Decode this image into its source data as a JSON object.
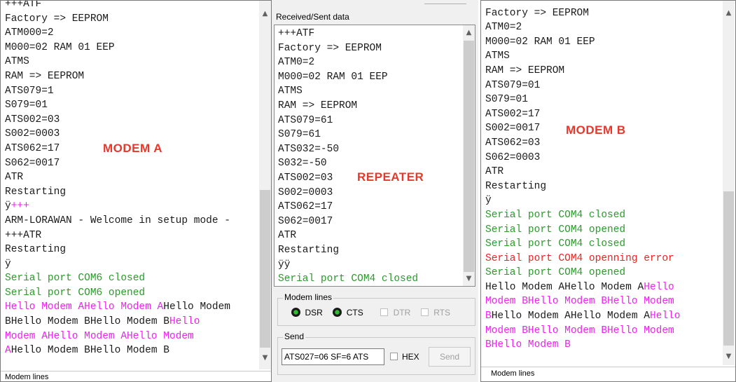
{
  "modem_a": {
    "label": "MODEM A",
    "lines": [
      [
        {
          "t": "+++ATF",
          "c": "dark"
        }
      ],
      [
        {
          "t": "Factory => EEPROM",
          "c": "dark"
        }
      ],
      [
        {
          "t": "ATM000=2",
          "c": "dark"
        }
      ],
      [
        {
          "t": "M000=02 RAM 01 EEP",
          "c": "dark"
        }
      ],
      [
        {
          "t": "ATMS",
          "c": "dark"
        }
      ],
      [
        {
          "t": "RAM => EEPROM",
          "c": "dark"
        }
      ],
      [
        {
          "t": "ATS079=1",
          "c": "dark"
        }
      ],
      [
        {
          "t": "S079=01",
          "c": "dark"
        }
      ],
      [
        {
          "t": "ATS002=03",
          "c": "dark"
        }
      ],
      [
        {
          "t": "S002=0003",
          "c": "dark"
        }
      ],
      [
        {
          "t": "ATS062=17",
          "c": "dark"
        }
      ],
      [
        {
          "t": "S062=0017",
          "c": "dark"
        }
      ],
      [
        {
          "t": "ATR",
          "c": "dark"
        }
      ],
      [
        {
          "t": "Restarting",
          "c": "dark"
        }
      ],
      [
        {
          "t": "ÿ",
          "c": "dark"
        },
        {
          "t": "+++",
          "c": "magenta"
        }
      ],
      [
        {
          "t": "ARM-LORAWAN - Welcome in setup mode -",
          "c": "dark"
        }
      ],
      [
        {
          "t": "+++ATR",
          "c": "dark"
        }
      ],
      [
        {
          "t": "Restarting",
          "c": "dark"
        }
      ],
      [
        {
          "t": "ÿ",
          "c": "dark"
        }
      ],
      [
        {
          "t": "Serial port COM6 closed",
          "c": "green"
        }
      ],
      [
        {
          "t": "Serial port COM6 opened",
          "c": "green"
        }
      ],
      [
        {
          "t": "Hello Modem AHello Modem A",
          "c": "magenta"
        },
        {
          "t": "Hello Modem",
          "c": "dark"
        }
      ],
      [
        {
          "t": "BHello Modem BHello Modem B",
          "c": "dark"
        },
        {
          "t": "Hello",
          "c": "magenta"
        }
      ],
      [
        {
          "t": "Modem AHello Modem AHello Modem",
          "c": "magenta"
        }
      ],
      [
        {
          "t": "A",
          "c": "magenta"
        },
        {
          "t": "Hello Modem BHello Modem B",
          "c": "dark"
        }
      ]
    ],
    "footer_label": "Modem lines"
  },
  "repeater": {
    "title": "Received/Sent data",
    "label": "REPEATER",
    "lines": [
      [
        {
          "t": "+++ATF",
          "c": "dark"
        }
      ],
      [
        {
          "t": "Factory => EEPROM",
          "c": "dark"
        }
      ],
      [
        {
          "t": "ATM0=2",
          "c": "dark"
        }
      ],
      [
        {
          "t": "M000=02 RAM 01 EEP",
          "c": "dark"
        }
      ],
      [
        {
          "t": "ATMS",
          "c": "dark"
        }
      ],
      [
        {
          "t": "RAM => EEPROM",
          "c": "dark"
        }
      ],
      [
        {
          "t": "ATS079=61",
          "c": "dark"
        }
      ],
      [
        {
          "t": "S079=61",
          "c": "dark"
        }
      ],
      [
        {
          "t": "ATS032=-50",
          "c": "dark"
        }
      ],
      [
        {
          "t": "S032=-50",
          "c": "dark"
        }
      ],
      [
        {
          "t": "ATS002=03",
          "c": "dark"
        }
      ],
      [
        {
          "t": "S002=0003",
          "c": "dark"
        }
      ],
      [
        {
          "t": "ATS062=17",
          "c": "dark"
        }
      ],
      [
        {
          "t": "S062=0017",
          "c": "dark"
        }
      ],
      [
        {
          "t": "ATR",
          "c": "dark"
        }
      ],
      [
        {
          "t": "Restarting",
          "c": "dark"
        }
      ],
      [
        {
          "t": "ÿÿ",
          "c": "dark"
        }
      ],
      [
        {
          "t": "Serial port COM4 closed",
          "c": "green"
        }
      ]
    ],
    "modem_lines": {
      "title": "Modem lines",
      "dsr": "DSR",
      "cts": "CTS",
      "dtr": "DTR",
      "rts": "RTS"
    },
    "send": {
      "title": "Send",
      "input_value": "ATS027=06 SF=6 ATS",
      "hex_label": "HEX",
      "send_button": "Send"
    }
  },
  "modem_b": {
    "label": "MODEM B",
    "lines": [
      [
        {
          "t": "+++ATF",
          "c": "dark"
        }
      ],
      [
        {
          "t": "Factory => EEPROM",
          "c": "dark"
        }
      ],
      [
        {
          "t": "ATM0=2",
          "c": "dark"
        }
      ],
      [
        {
          "t": "M000=02 RAM 01 EEP",
          "c": "dark"
        }
      ],
      [
        {
          "t": "ATMS",
          "c": "dark"
        }
      ],
      [
        {
          "t": "RAM => EEPROM",
          "c": "dark"
        }
      ],
      [
        {
          "t": "ATS079=01",
          "c": "dark"
        }
      ],
      [
        {
          "t": "S079=01",
          "c": "dark"
        }
      ],
      [
        {
          "t": "ATS002=17",
          "c": "dark"
        }
      ],
      [
        {
          "t": "S002=0017",
          "c": "dark"
        }
      ],
      [
        {
          "t": "ATS062=03",
          "c": "dark"
        }
      ],
      [
        {
          "t": "S062=0003",
          "c": "dark"
        }
      ],
      [
        {
          "t": "ATR",
          "c": "dark"
        }
      ],
      [
        {
          "t": "Restarting",
          "c": "dark"
        }
      ],
      [
        {
          "t": "ÿ",
          "c": "dark"
        }
      ],
      [
        {
          "t": "Serial port COM4 closed",
          "c": "green"
        }
      ],
      [
        {
          "t": "Serial port COM4 opened",
          "c": "green"
        }
      ],
      [
        {
          "t": "Serial port COM4 closed",
          "c": "green"
        }
      ],
      [
        {
          "t": "Serial port COM4 openning error",
          "c": "red"
        }
      ],
      [
        {
          "t": "Serial port COM4 opened",
          "c": "green"
        }
      ],
      [
        {
          "t": "Hello Modem AHello Modem A",
          "c": "dark"
        },
        {
          "t": "Hello",
          "c": "magenta"
        }
      ],
      [
        {
          "t": "Modem BHello Modem BHello Modem",
          "c": "magenta"
        }
      ],
      [
        {
          "t": "B",
          "c": "magenta"
        },
        {
          "t": "Hello Modem AHello Modem A",
          "c": "dark"
        },
        {
          "t": "Hello",
          "c": "magenta"
        }
      ],
      [
        {
          "t": "Modem BHello Modem BHello Modem",
          "c": "magenta"
        }
      ],
      [
        {
          "t": "BHello Modem B",
          "c": "magenta"
        }
      ]
    ],
    "footer_label": "Modem lines"
  },
  "colors": {
    "green_text": "#2a9a2a",
    "magenta_text": "#ee22ee",
    "red_text": "#ee2222",
    "label_red": "#e8372b",
    "led_green": "#2dbe2d"
  },
  "icons": {
    "scroll_up": "scroll-up-arrow-icon",
    "scroll_down": "scroll-down-arrow-icon",
    "led": "led-indicator-icon"
  }
}
